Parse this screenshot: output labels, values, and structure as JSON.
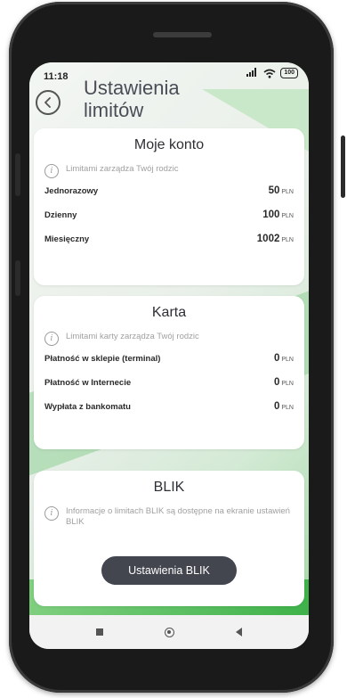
{
  "status": {
    "time": "11:18",
    "battery": "100",
    "signal_icon": "signal-icon",
    "wifi_icon": "wifi-icon"
  },
  "header": {
    "title_line1": "Ustawienia",
    "title_line2": "limitów",
    "back_icon": "back-arrow-icon"
  },
  "moje_konto": {
    "title": "Moje konto",
    "info": "Limitami zarządza Twój rodzic",
    "rows": [
      {
        "label": "Jednorazowy",
        "value": "50",
        "currency": "PLN"
      },
      {
        "label": "Dzienny",
        "value": "100",
        "currency": "PLN"
      },
      {
        "label": "Miesięczny",
        "value": "1002",
        "currency": "PLN"
      }
    ]
  },
  "karta": {
    "title": "Karta",
    "info": "Limitami karty zarządza Twój rodzic",
    "rows": [
      {
        "label": "Płatność w sklepie (terminal)",
        "value": "0",
        "currency": "PLN"
      },
      {
        "label": "Płatność w Internecie",
        "value": "0",
        "currency": "PLN"
      },
      {
        "label": "Wypłata z bankomatu",
        "value": "0",
        "currency": "PLN"
      }
    ]
  },
  "blik": {
    "title": "BLIK",
    "info": "Informacje o limitach BLIK są dostępne na ekranie ustawień BLIK",
    "button": "Ustawienia BLIK"
  },
  "colors": {
    "accent_green": "#3fb24a",
    "button_dark": "#43464f"
  }
}
